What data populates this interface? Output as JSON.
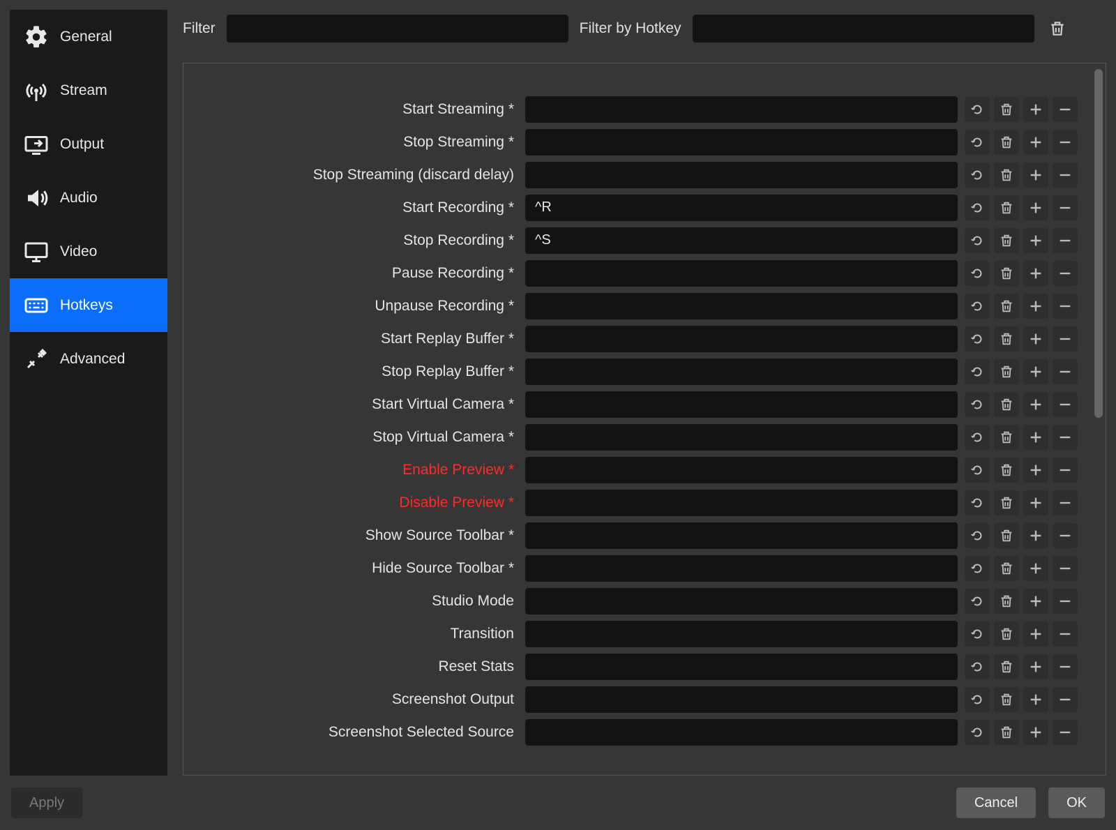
{
  "sidebar": {
    "items": [
      {
        "label": "General",
        "icon": "gear",
        "active": false
      },
      {
        "label": "Stream",
        "icon": "antenna",
        "active": false
      },
      {
        "label": "Output",
        "icon": "output",
        "active": false
      },
      {
        "label": "Audio",
        "icon": "speaker",
        "active": false
      },
      {
        "label": "Video",
        "icon": "monitor",
        "active": false
      },
      {
        "label": "Hotkeys",
        "icon": "keyboard",
        "active": true
      },
      {
        "label": "Advanced",
        "icon": "tools",
        "active": false
      }
    ]
  },
  "filters": {
    "filter_label": "Filter",
    "filter_value": "",
    "filter_by_hotkey_label": "Filter by Hotkey",
    "filter_by_hotkey_value": ""
  },
  "hotkeys": [
    {
      "label": "Start Streaming *",
      "value": "",
      "red": false
    },
    {
      "label": "Stop Streaming *",
      "value": "",
      "red": false
    },
    {
      "label": "Stop Streaming (discard delay)",
      "value": "",
      "red": false
    },
    {
      "label": "Start Recording *",
      "value": "^R",
      "red": false
    },
    {
      "label": "Stop Recording *",
      "value": "^S",
      "red": false
    },
    {
      "label": "Pause Recording *",
      "value": "",
      "red": false
    },
    {
      "label": "Unpause Recording *",
      "value": "",
      "red": false
    },
    {
      "label": "Start Replay Buffer *",
      "value": "",
      "red": false
    },
    {
      "label": "Stop Replay Buffer *",
      "value": "",
      "red": false
    },
    {
      "label": "Start Virtual Camera *",
      "value": "",
      "red": false
    },
    {
      "label": "Stop Virtual Camera *",
      "value": "",
      "red": false
    },
    {
      "label": "Enable Preview *",
      "value": "",
      "red": true
    },
    {
      "label": "Disable Preview *",
      "value": "",
      "red": true
    },
    {
      "label": "Show Source Toolbar *",
      "value": "",
      "red": false
    },
    {
      "label": "Hide Source Toolbar *",
      "value": "",
      "red": false
    },
    {
      "label": "Studio Mode",
      "value": "",
      "red": false
    },
    {
      "label": "Transition",
      "value": "",
      "red": false
    },
    {
      "label": "Reset Stats",
      "value": "",
      "red": false
    },
    {
      "label": "Screenshot Output",
      "value": "",
      "red": false
    },
    {
      "label": "Screenshot Selected Source",
      "value": "",
      "red": false
    }
  ],
  "footer": {
    "apply": "Apply",
    "cancel": "Cancel",
    "ok": "OK"
  }
}
